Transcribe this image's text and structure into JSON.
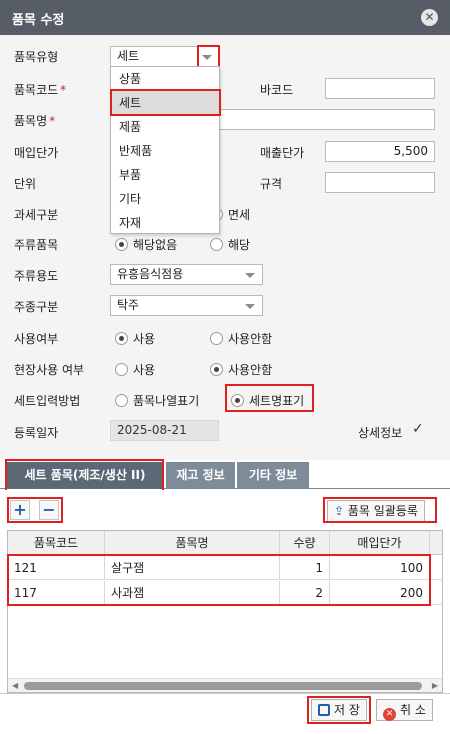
{
  "dialog": {
    "title": "품목 수정",
    "close_icon": "close-icon"
  },
  "form": {
    "item_type": {
      "label": "품목유형",
      "value": "세트"
    },
    "dropdown_options": [
      "상품",
      "세트",
      "제품",
      "반제품",
      "부품",
      "기타",
      "자재"
    ],
    "dropdown_selected": "세트",
    "item_code": {
      "label": "품목코드",
      "required": "*"
    },
    "barcode": {
      "label": "바코드",
      "value": ""
    },
    "item_name": {
      "label": "품목명",
      "required": "*"
    },
    "purchase_price": {
      "label": "매입단가"
    },
    "sales_price": {
      "label": "매출단가",
      "value": "5,500"
    },
    "unit": {
      "label": "단위"
    },
    "spec": {
      "label": "규격",
      "value": ""
    },
    "tax_type": {
      "label": "과세구분",
      "option_visible": "면세"
    },
    "liquor_item": {
      "label": "주류품목",
      "options": [
        "해당없음",
        "해당"
      ],
      "selected": "해당없음"
    },
    "liquor_use": {
      "label": "주류용도",
      "value": "유흥음식점용"
    },
    "liquor_kind": {
      "label": "주종구분",
      "value": "탁주"
    },
    "use_flag": {
      "label": "사용여부",
      "options": [
        "사용",
        "사용안함"
      ],
      "selected": "사용"
    },
    "site_use_flag": {
      "label": "현장사용 여부",
      "options": [
        "사용",
        "사용안함"
      ],
      "selected": "사용안함"
    },
    "set_input_method": {
      "label": "세트입력방법",
      "options": [
        "품목나열표기",
        "세트명표기"
      ],
      "selected": "세트명표기"
    },
    "reg_date": {
      "label": "등록일자",
      "value": "2025-08-21"
    },
    "detail_info": {
      "label": "상세정보",
      "checked": true
    }
  },
  "tabs": [
    "세트 품목(제조/생산 II)",
    "재고 정보",
    "기타 정보"
  ],
  "toolbar": {
    "add_icon": "plus-icon",
    "remove_icon": "minus-icon",
    "bulk_register_label": "품목 일괄등록"
  },
  "grid": {
    "columns": [
      "품목코드",
      "품목명",
      "수량",
      "매입단가"
    ],
    "rows": [
      {
        "code": "121",
        "name": "살구잼",
        "qty": "1",
        "price": "100"
      },
      {
        "code": "117",
        "name": "사과잼",
        "qty": "2",
        "price": "200"
      }
    ]
  },
  "footer": {
    "save_label": "저 장",
    "cancel_label": "취 소"
  },
  "colors": {
    "titlebar": "#575d66",
    "tab_active": "#5c6876",
    "tab": "#7e8b98",
    "highlight": "#e02020",
    "accent_blue": "#1f5fae"
  }
}
